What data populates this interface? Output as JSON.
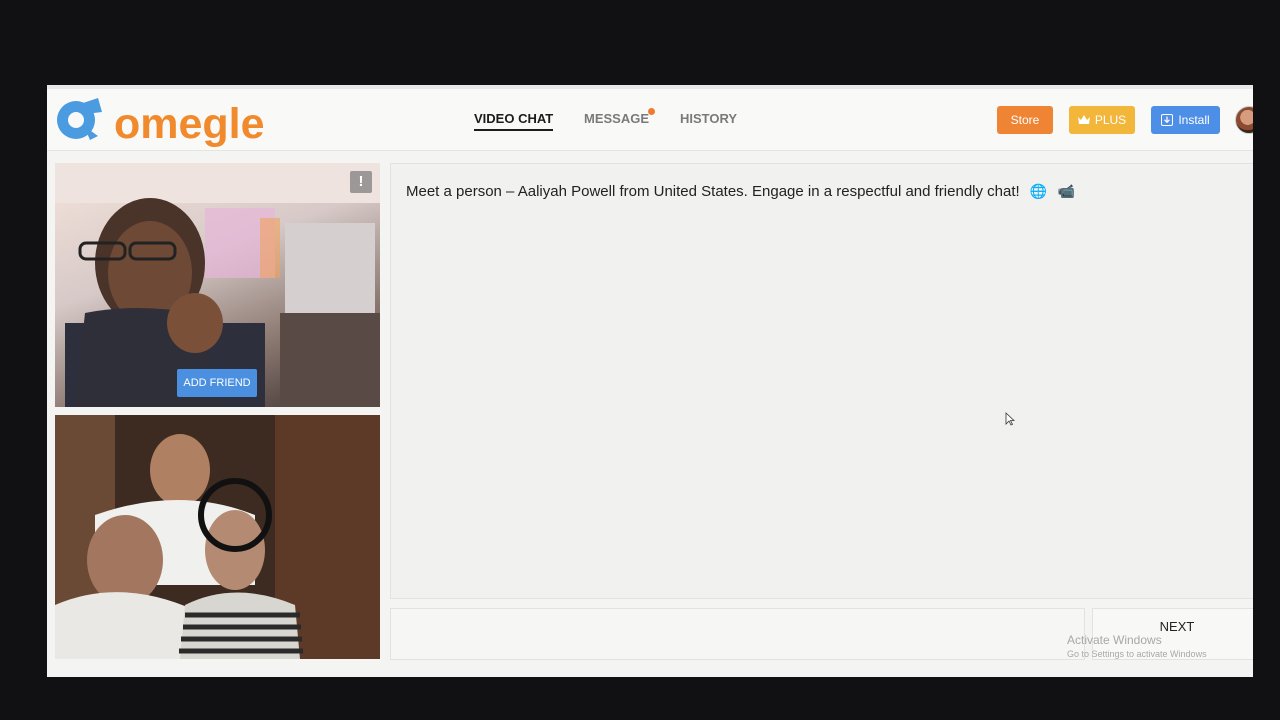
{
  "brand": {
    "name": "omegle",
    "accent": "#f08a2c",
    "logo_blue": "#4a9be0"
  },
  "nav": {
    "tabs": [
      {
        "label": "VIDEO CHAT",
        "active": true
      },
      {
        "label": "MESSAGE",
        "active": false,
        "has_notification_dot": true
      },
      {
        "label": "HISTORY",
        "active": false
      }
    ]
  },
  "header_buttons": {
    "store": {
      "label": "Store",
      "color": "#ef8435"
    },
    "plus": {
      "label": "PLUS",
      "icon": "crown-icon",
      "color": "#f2b63a"
    },
    "install": {
      "label": "Install",
      "icon": "download-icon",
      "color": "#4d8fe6"
    }
  },
  "video": {
    "remote": {
      "add_friend_label": "ADD FRIEND",
      "report_icon": "report-icon",
      "report_symbol": "!"
    },
    "local": {}
  },
  "chat": {
    "message": "Meet a person – Aaliyah Powell from United States. Engage in a respectful and friendly chat!",
    "message_icons": [
      "globe-icon",
      "video-camera-icon"
    ],
    "globe_emoji": "🌐",
    "camera_emoji": "📹"
  },
  "controls": {
    "next_label": "NEXT"
  },
  "watermark": {
    "line1": "Activate Windows",
    "line2": "Go to Settings to activate Windows"
  }
}
